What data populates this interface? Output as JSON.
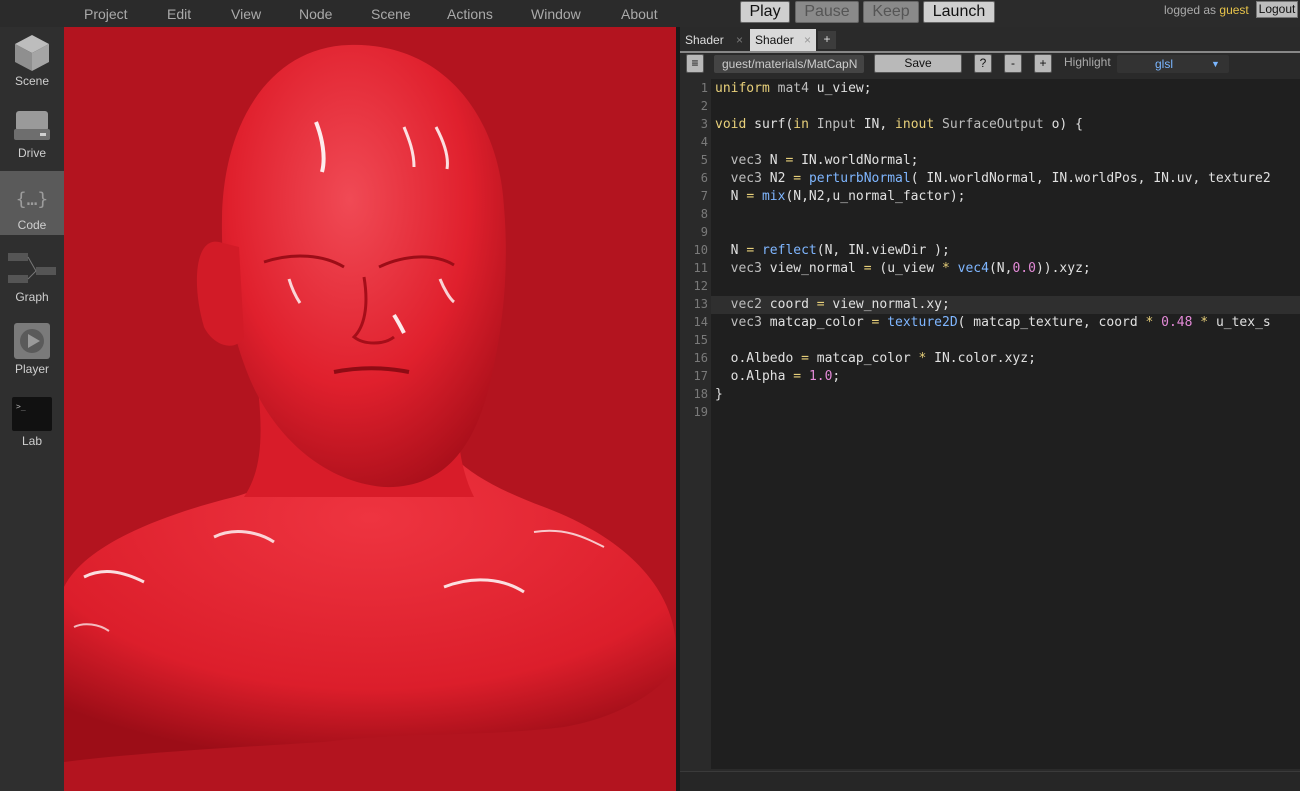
{
  "menu": {
    "items": [
      "Project",
      "Edit",
      "View",
      "Node",
      "Scene",
      "Actions",
      "Window",
      "About"
    ]
  },
  "controls": {
    "play": "Play",
    "pause": "Pause",
    "keep": "Keep",
    "launch": "Launch"
  },
  "session": {
    "prefix": "logged as",
    "user": "guest",
    "logout": "Logout"
  },
  "sidebar": {
    "items": [
      {
        "label": "Scene",
        "icon": "cube-icon"
      },
      {
        "label": "Drive",
        "icon": "hard-drive-icon"
      },
      {
        "label": "Code",
        "icon": "code-braces-icon",
        "active": true
      },
      {
        "label": "Graph",
        "icon": "graph-nodes-icon"
      },
      {
        "label": "Player",
        "icon": "play-circle-icon"
      },
      {
        "label": "Lab",
        "icon": "terminal-icon"
      }
    ]
  },
  "editor": {
    "tabs": [
      {
        "label": "Shader",
        "close": "×"
      },
      {
        "label": "Shader",
        "close": "×",
        "active": true
      }
    ],
    "add_tab": "+",
    "toolbar": {
      "menu_icon": "≡",
      "path": "guest/materials/MatCapN",
      "save": "Save",
      "help": "?",
      "zoom_out": "-",
      "zoom_in": "+",
      "highlight_label": "Highlight",
      "highlight_value": "glsl",
      "highlight_arrow": "▼"
    },
    "line_numbers": [
      "1",
      "2",
      "3",
      "4",
      "5",
      "6",
      "7",
      "8",
      "9",
      "10",
      "11",
      "12",
      "13",
      "14",
      "15",
      "16",
      "17",
      "18",
      "19"
    ],
    "current_line": 13,
    "code": [
      "uniform mat4 u_view;",
      "",
      "void surf(in Input IN, inout SurfaceOutput o) {",
      "",
      "  vec3 N = IN.worldNormal;",
      "  vec3 N2 = perturbNormal( IN.worldNormal, IN.worldPos, IN.uv, texture2",
      "  N = mix(N,N2,u_normal_factor);",
      "",
      "",
      "  N = reflect(N, IN.viewDir );",
      "  vec3 view_normal = (u_view * vec4(N,0.0)).xyz;",
      "",
      "  vec2 coord = view_normal.xy;",
      "  vec3 matcap_color = texture2D( matcap_texture, coord * 0.48 * u_tex_s",
      "",
      "  o.Albedo = matcap_color * IN.color.xyz;",
      "  o.Alpha = 1.0;",
      "}",
      ""
    ]
  },
  "colors": {
    "viewport_bg": "#b3141f",
    "model_red": "#e82a36",
    "keyword": "#e8d07a",
    "function": "#7fb6ff",
    "number": "#e38ad7"
  }
}
